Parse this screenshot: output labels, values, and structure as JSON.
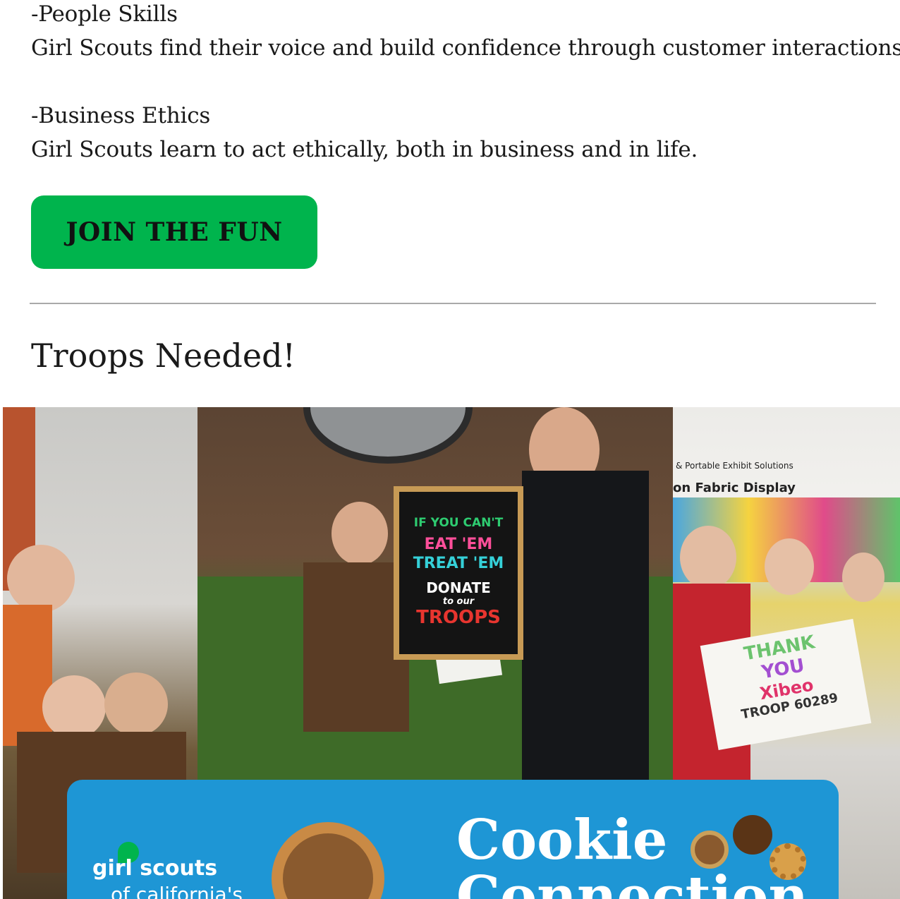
{
  "benefits": [
    {
      "title": "-People Skills",
      "description": "Girl Scouts find their voice and build confidence through customer interactions."
    },
    {
      "title": "-Business Ethics",
      "description": "Girl Scouts learn to act ethically, both in business and in life."
    }
  ],
  "cta": {
    "label": "JOIN THE FUN",
    "color": "#00b44d"
  },
  "section": {
    "heading": "Troops Needed!"
  },
  "collage": {
    "board": {
      "line1": "IF YOU CAN'T",
      "line2": "EAT 'EM",
      "line3": "TREAT 'EM",
      "line4": "DONATE",
      "line5": "to our",
      "line6": "TROOPS"
    },
    "right_sign": {
      "line1": "& Portable Exhibit Solutions",
      "line2": "on Fabric Display"
    },
    "poster": {
      "line1": "THANK",
      "line2": "YOU",
      "line3": "Xibeo",
      "line4": "TROOP 60289"
    },
    "banner": {
      "brand": "girl scouts",
      "brand_sub": "of california's",
      "title1": "Cookie",
      "title2": "Connection",
      "color": "#1e96d5"
    }
  }
}
